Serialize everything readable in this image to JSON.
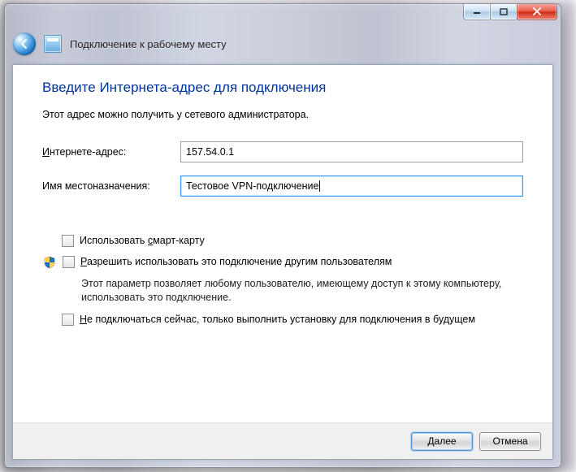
{
  "header": {
    "title": "Подключение к рабочему месту"
  },
  "page": {
    "title": "Введите Интернета-адрес для подключения",
    "subtext": "Этот адрес можно получить у сетевого администратора."
  },
  "form": {
    "address": {
      "hotkey": "И",
      "label_rest": "нтернете-адрес:",
      "value": "157.54.0.1"
    },
    "name": {
      "label": "Имя местоназначения:",
      "value": "Тестовое VPN-подключение"
    }
  },
  "options": {
    "smartcard": {
      "pre": "Использовать ",
      "hotkey": "с",
      "post": "март-карту"
    },
    "allow_others": {
      "hotkey": "Р",
      "post": "азрешить использовать это подключение другим пользователям",
      "help": "Этот параметр позволяет любому пользователю, имеющему доступ к этому компьютеру, использовать это подключение."
    },
    "dont_connect": {
      "hotkey": "Н",
      "post": "е подключаться сейчас, только выполнить установку для подключения в будущем"
    }
  },
  "footer": {
    "next": "Далее",
    "cancel": "Отмена"
  }
}
